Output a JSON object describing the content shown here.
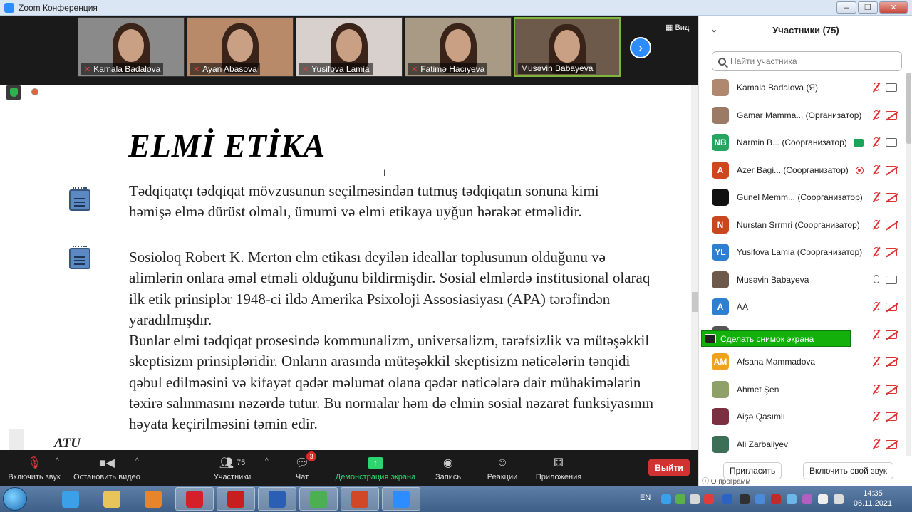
{
  "window": {
    "title": "Zoom Конференция",
    "minimize": "–",
    "maximize": "❐",
    "close": "✕"
  },
  "videos": [
    {
      "name": "Kamala Badalova",
      "bg": "#8a8a8a",
      "active": false
    },
    {
      "name": "Ayan Abasova",
      "bg": "#b88a6a",
      "active": false
    },
    {
      "name": "Yusifova Lamia",
      "bg": "#d7d0cc",
      "active": false
    },
    {
      "name": "Fatimə Hacıyeva",
      "bg": "#a99a86",
      "active": false
    },
    {
      "name": "Musəvin Babayeva",
      "bg": "#6e5a4a",
      "active": true
    }
  ],
  "view_label": "Вид",
  "slide": {
    "title": "ELMİ ETİKA",
    "para1": "Tədqiqatçı tədqiqat mövzusunun seçilməsindən tutmuş tədqiqatın sonuna kimi həmişə elmə dürüst olmalı, ümumi və elmi etikaya uyğun hərəkət etməlidir.",
    "para2a": "Sosioloq Robert K. Merton elm etikası deyilən ideallar toplusunun olduğunu və alimlərin onlara əməl etməli olduğunu bildirmişdir. Sosial elmlərdə institusional olaraq ilk etik prinsiplər 1948-ci ildə Amerika Psixoloji Assosiasiyası (APA) tərəfindən yaradılmışdır.",
    "para2b": "Bunlar elmi tədqiqat prosesində kommunalizm, universalizm, tərəfsizlik və mütəşəkkil skeptisizm prinsipləridir. Onların arasında mütəşəkkil skeptisizm nəticələrin tənqidi qəbul edilməsini və kifayət qədər məlumat olana qədər nəticələrə dair mühakimələrin təxirə salınmasını nəzərdə tutur. Bu normalar həm də elmin sosial nəzarət funksiyasının həyata keçirilməsini təmin edir.",
    "footer": "ATU"
  },
  "panel": {
    "title": "Участники (75)",
    "search_placeholder": "Найти участника",
    "participants": [
      {
        "avatar": "",
        "color": "#b08870",
        "name": "Kamala Badalova (Я)",
        "mic": "off",
        "cam": "on",
        "extra": ""
      },
      {
        "avatar": "",
        "color": "#9c7b66",
        "name": "Gamar Mamma...  (Организатор)",
        "mic": "off",
        "cam": "off",
        "extra": ""
      },
      {
        "avatar": "NB",
        "color": "#27a560",
        "name": "Narmin B...  (Соорганизатор)",
        "mic": "off",
        "cam": "on",
        "extra": "share"
      },
      {
        "avatar": "A",
        "color": "#d0461f",
        "name": "Azer Bagi...  (Соорганизатор)",
        "mic": "off",
        "cam": "off",
        "extra": "rec"
      },
      {
        "avatar": "",
        "color": "#111111",
        "name": "Gunel Memm...  (Соорганизатор)",
        "mic": "off",
        "cam": "off",
        "extra": ""
      },
      {
        "avatar": "N",
        "color": "#c8471f",
        "name": "Nurstan Srrmri (Соорганизатор)",
        "mic": "off",
        "cam": "off",
        "extra": ""
      },
      {
        "avatar": "YL",
        "color": "#2f7fd0",
        "name": "Yusifova Lamia (Соорганизатор)",
        "mic": "off",
        "cam": "off",
        "extra": ""
      },
      {
        "avatar": "",
        "color": "#6e5a4a",
        "name": "Musəvin Babayeva",
        "mic": "on",
        "cam": "on",
        "extra": ""
      },
      {
        "avatar": "A",
        "color": "#2f7fd0",
        "name": "AA",
        "mic": "off",
        "cam": "off",
        "extra": ""
      },
      {
        "avatar": "",
        "color": "#555555",
        "name": "",
        "mic": "off",
        "cam": "off",
        "extra": ""
      },
      {
        "avatar": "AM",
        "color": "#f0a21f",
        "name": "Afsana Mammadova",
        "mic": "off",
        "cam": "off",
        "extra": ""
      },
      {
        "avatar": "",
        "color": "#8fa168",
        "name": "Ahmet Şen",
        "mic": "off",
        "cam": "off",
        "extra": ""
      },
      {
        "avatar": "",
        "color": "#7a3040",
        "name": "Aişə Qasımlı",
        "mic": "off",
        "cam": "off",
        "extra": ""
      },
      {
        "avatar": "",
        "color": "#3c6e58",
        "name": "Ali Zarbaliyev",
        "mic": "off",
        "cam": "off",
        "extra": ""
      }
    ],
    "invite": "Пригласить",
    "unmute_self": "Включить свой звук",
    "about": "О программ"
  },
  "snapshot": "Сделать снимок экрана",
  "toolbar": {
    "audio": "Включить звук",
    "video": "Остановить видео",
    "participants": "Участники",
    "participants_count": "75",
    "chat": "Чат",
    "chat_badge": "3",
    "share": "Демонстрация экрана",
    "record": "Запись",
    "reactions": "Реакции",
    "apps": "Приложения",
    "leave": "Выйти"
  },
  "taskbar": {
    "lang": "EN",
    "time": "14:35",
    "date": "06.11.2021",
    "apps": [
      {
        "name": "ie-icon",
        "color": "#3aa0e8"
      },
      {
        "name": "explorer-icon",
        "color": "#e8c45a"
      },
      {
        "name": "media-icon",
        "color": "#e8842a"
      },
      {
        "name": "opera-icon",
        "color": "#d4202a"
      },
      {
        "name": "acrobat-icon",
        "color": "#c81e1e"
      },
      {
        "name": "word-icon",
        "color": "#2b5fb4"
      },
      {
        "name": "chrome-icon",
        "color": "#4caf50"
      },
      {
        "name": "powerpoint-icon",
        "color": "#d24726"
      },
      {
        "name": "zoom-icon",
        "color": "#2d8cff"
      }
    ]
  }
}
